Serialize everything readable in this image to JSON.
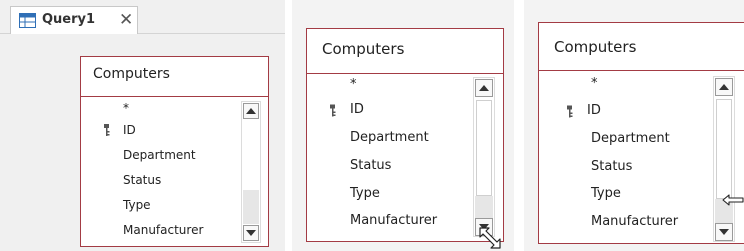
{
  "tab": {
    "label": "Query1",
    "close": "✕",
    "icon": "query-datasheet-icon"
  },
  "table": {
    "title": "Computers",
    "fields": [
      "*",
      "ID",
      "Department",
      "Status",
      "Type",
      "Manufacturer"
    ],
    "key_field": "ID"
  },
  "icons": [
    "primary-key-icon",
    "scroll-up-arrow-icon",
    "scroll-down-arrow-icon",
    "resize-diagonal-cursor-icon",
    "resize-horizontal-cursor-icon"
  ],
  "colors": {
    "window_border": "#a33b44",
    "scroll_track": "#e6e6e6",
    "tab_icon": "#2f6fb6"
  }
}
